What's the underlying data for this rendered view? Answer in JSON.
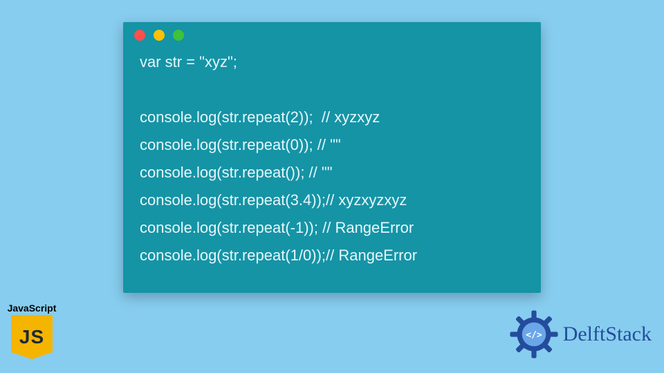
{
  "window": {
    "dots": [
      "red",
      "yellow",
      "green"
    ]
  },
  "code": {
    "lines": [
      "var str = \"xyz\";",
      "",
      "console.log(str.repeat(2));  // xyzxyz",
      "console.log(str.repeat(0)); // \"\"",
      "console.log(str.repeat()); // \"\"",
      "console.log(str.repeat(3.4));// xyzxyzxyz",
      "console.log(str.repeat(-1)); // RangeError",
      "console.log(str.repeat(1/0));// RangeError"
    ]
  },
  "js_badge": {
    "label": "JavaScript",
    "logo_text": "JS"
  },
  "brand": {
    "name": "DelftStack"
  },
  "colors": {
    "bg": "#87cdef",
    "window": "#1594a6",
    "js_logo": "#f5b400",
    "brand_text": "#244c9c"
  }
}
